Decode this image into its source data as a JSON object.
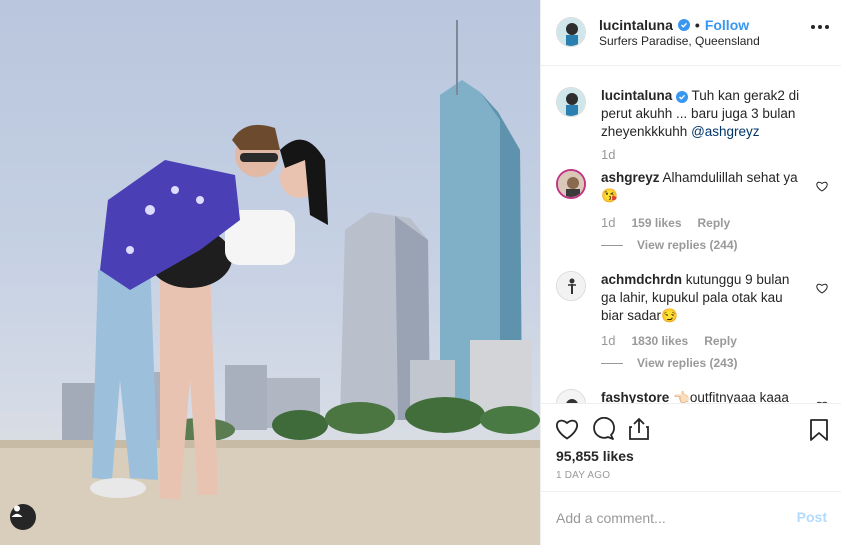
{
  "post": {
    "username": "lucintaluna",
    "separator": "•",
    "follow_label": "Follow",
    "location": "Surfers Paradise, Queensland"
  },
  "caption": {
    "username": "lucintaluna",
    "text": "Tuh kan gerak2 di perut akuhh ... baru juga 3 bulan zheyenkkkuhh",
    "mention": "@ashgreyz",
    "age": "1d"
  },
  "comments": [
    {
      "username": "ashgreyz",
      "text": "Alhamdulillah sehat ya 😘",
      "age": "1d",
      "likes": "159 likes",
      "reply_label": "Reply",
      "view_replies": "View replies (244)"
    },
    {
      "username": "achmdchrdn",
      "text": "kutunggu 9 bulan ga lahir, kupukul pala otak kau biar sadar😏",
      "age": "1d",
      "likes": "1830 likes",
      "reply_label": "Reply",
      "view_replies": "View replies (243)"
    },
    {
      "username": "fashystore",
      "text": "👈🏻outfitnyaaa kaaa"
    }
  ],
  "engagement": {
    "likes": "95,855 likes",
    "time_ago": "1 DAY AGO"
  },
  "composer": {
    "placeholder": "Add a comment...",
    "post_label": "Post"
  },
  "icons": {
    "like": "heart-icon",
    "comment": "comment-bubble-icon",
    "share": "share-icon",
    "save": "bookmark-icon",
    "tags": "user-tag-icon",
    "more": "more-options-icon"
  },
  "colors": {
    "link": "#3897f0",
    "mention": "#003569",
    "muted": "#999999",
    "border": "#efefef"
  }
}
